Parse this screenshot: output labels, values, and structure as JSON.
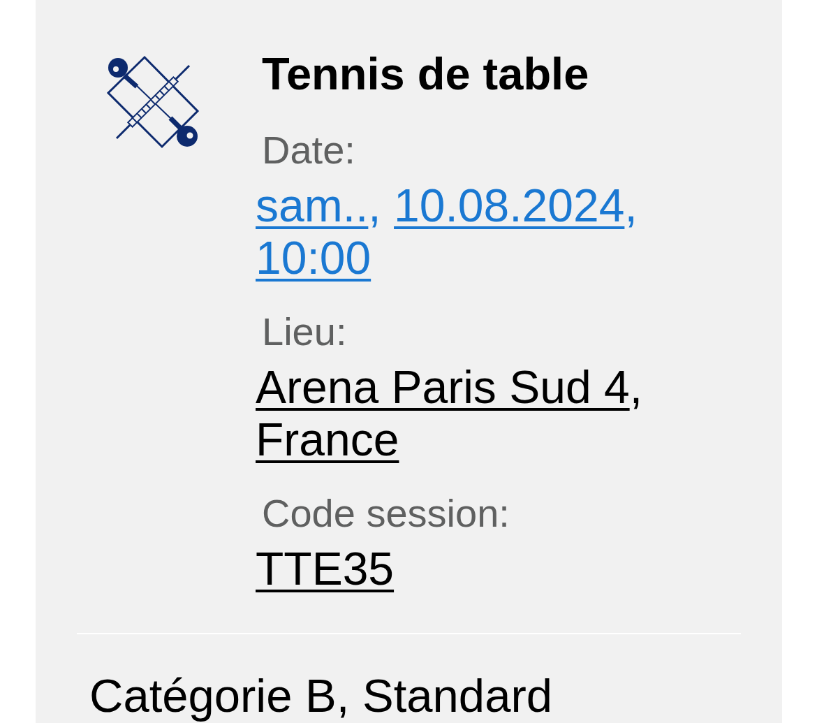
{
  "event": {
    "title": "Tennis de table",
    "fields": [
      {
        "label": "Date:",
        "color": "#1a78d2",
        "parts": [
          {
            "kind": "link",
            "text": "sam.."
          },
          {
            "kind": "separator",
            "text": ", "
          },
          {
            "kind": "link",
            "text": "10.08.2024"
          },
          {
            "kind": "separator",
            "text": ", "
          },
          {
            "kind": "link",
            "text": "10:00"
          }
        ]
      },
      {
        "label": "Lieu:",
        "color": "#000000",
        "parts": [
          {
            "kind": "link",
            "text": "Arena Paris Sud 4"
          },
          {
            "kind": "separator",
            "text": ", "
          },
          {
            "kind": "link",
            "text": "France"
          }
        ]
      },
      {
        "label": "Code session:",
        "color": "#000000",
        "parts": [
          {
            "kind": "link",
            "text": "TTE35"
          }
        ]
      }
    ]
  },
  "category": "Catégorie B, Standard"
}
